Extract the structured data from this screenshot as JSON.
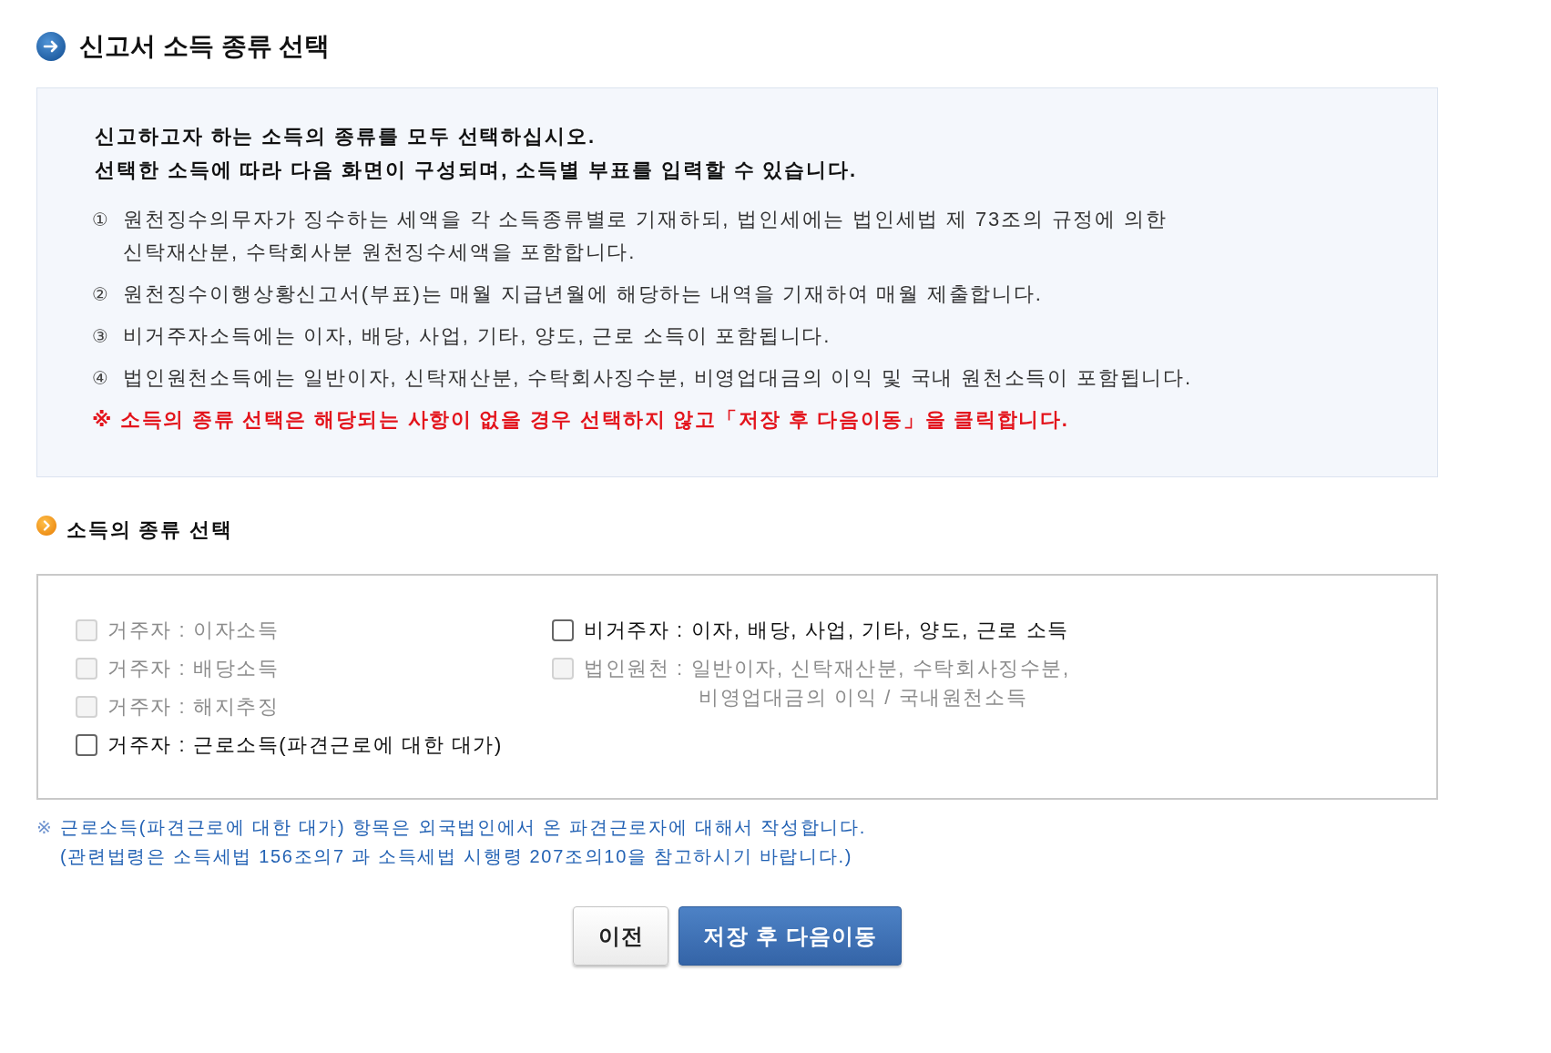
{
  "page_title": {
    "text": "신고서 소득 종류 선택"
  },
  "instructions": {
    "headline": [
      "신고하고자 하는 소득의 종류를 모두 선택하십시오.",
      "선택한 소득에 따라 다음 화면이 구성되며, 소득별 부표를 입력할 수 있습니다."
    ],
    "notes": [
      {
        "number": "①",
        "lines": [
          "원천징수의무자가 징수하는 세액을 각 소득종류별로 기재하되, 법인세에는 법인세법 제 73조의 규정에 의한",
          "신탁재산분, 수탁회사분 원천징수세액을 포함합니다."
        ]
      },
      {
        "number": "②",
        "lines": [
          "원천징수이행상황신고서(부표)는 매월 지급년월에 해당하는 내역을 기재하여 매월 제출합니다."
        ]
      },
      {
        "number": "③",
        "lines": [
          "비거주자소득에는 이자, 배당, 사업, 기타, 양도, 근로 소득이 포함됩니다."
        ]
      },
      {
        "number": "④",
        "lines": [
          "법인원천소득에는 일반이자, 신탁재산분, 수탁회사징수분, 비영업대금의 이익 및 국내 원천소득이 포함됩니다."
        ]
      }
    ],
    "warning": "※ 소득의 종류 선택은 해당되는 사항이 없을 경우 선택하지 않고「저장 후 다음이동」을 클릭합니다."
  },
  "income_section": {
    "title": "소득의 종류 선택",
    "columns": [
      {
        "options": [
          {
            "lines": [
              "거주자 : 이자소득"
            ],
            "checked": false,
            "disabled": true
          },
          {
            "lines": [
              "거주자 : 배당소득"
            ],
            "checked": false,
            "disabled": true
          },
          {
            "lines": [
              "거주자 : 해지추징"
            ],
            "checked": false,
            "disabled": true
          },
          {
            "lines": [
              "거주자 : 근로소득(파견근로에 대한 대가)"
            ],
            "checked": false,
            "disabled": false
          }
        ]
      },
      {
        "options": [
          {
            "lines": [
              "비거주자 : 이자, 배당, 사업, 기타, 양도, 근로 소득"
            ],
            "checked": false,
            "disabled": false
          },
          {
            "lines": [
              "법인원천 : 일반이자, 신탁재산분, 수탁회사징수분,",
              "비영업대금의 이익 / 국내원천소득"
            ],
            "checked": false,
            "disabled": true
          }
        ]
      }
    ]
  },
  "footnote": {
    "mark": "※",
    "lines": [
      "근로소득(파견근로에 대한 대가) 항목은 외국법인에서 온 파견근로자에 대해서 작성합니다.",
      "(관련법령은 소득세법 156조의7 과 소득세법 시행령 207조의10을 참고하시기 바랍니다.)"
    ]
  },
  "buttons": [
    {
      "label": "이전",
      "kind": "secondary"
    },
    {
      "label": "저장 후 다음이동",
      "kind": "primary"
    }
  ]
}
